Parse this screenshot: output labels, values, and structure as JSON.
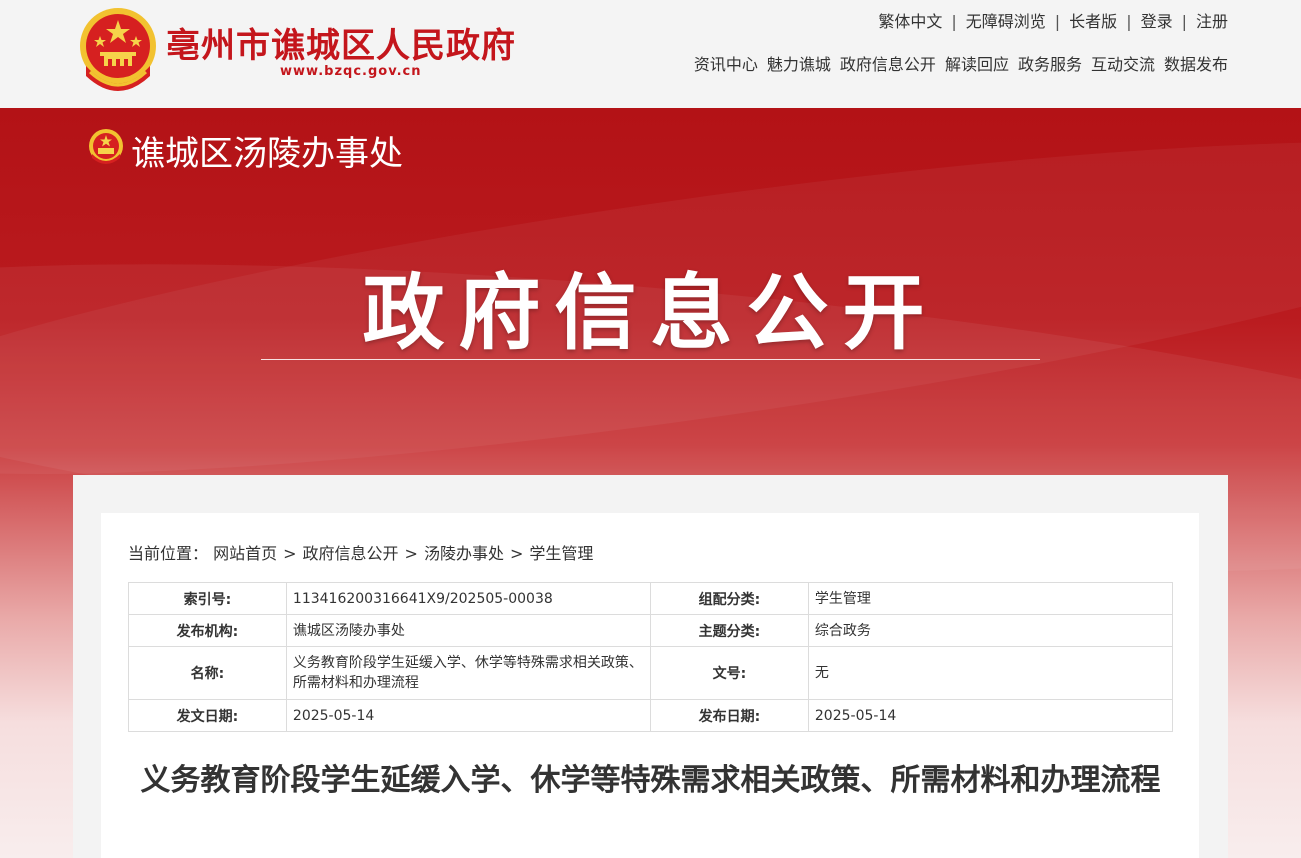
{
  "header": {
    "site_title": "亳州市谯城区人民政府",
    "site_url": "www.bzqc.gov.cn",
    "utility_links": [
      "繁体中文",
      "无障碍浏览",
      "长者版",
      "登录",
      "注册"
    ],
    "nav": [
      "资讯中心",
      "魅力谯城",
      "政府信息公开",
      "解读回应",
      "政务服务",
      "互动交流",
      "数据发布"
    ]
  },
  "banner": {
    "department": "谯城区汤陵办事处",
    "section_title": "政府信息公开"
  },
  "breadcrumb": {
    "prefix": "当前位置：",
    "items": [
      "网站首页",
      "政府信息公开",
      "汤陵办事处",
      "学生管理"
    ],
    "separator": ">"
  },
  "meta": {
    "index_no_label": "索引号:",
    "index_no": "113416200316641X9/202505-00038",
    "category_label": "组配分类:",
    "category": "学生管理",
    "publisher_label": "发布机构:",
    "publisher": "谯城区汤陵办事处",
    "topic_label": "主题分类:",
    "topic": "综合政务",
    "name_label": "名称:",
    "name": "义务教育阶段学生延缓入学、休学等特殊需求相关政策、所需材料和办理流程",
    "doc_no_label": "文号:",
    "doc_no": "无",
    "doc_date_label": "发文日期:",
    "doc_date": "2025-05-14",
    "pub_date_label": "发布日期:",
    "pub_date": "2025-05-14"
  },
  "article": {
    "title": "义务教育阶段学生延缓入学、休学等特殊需求相关政策、所需材料和办理流程"
  },
  "colors": {
    "brand_red": "#c4161c",
    "banner_red": "#b31216"
  }
}
